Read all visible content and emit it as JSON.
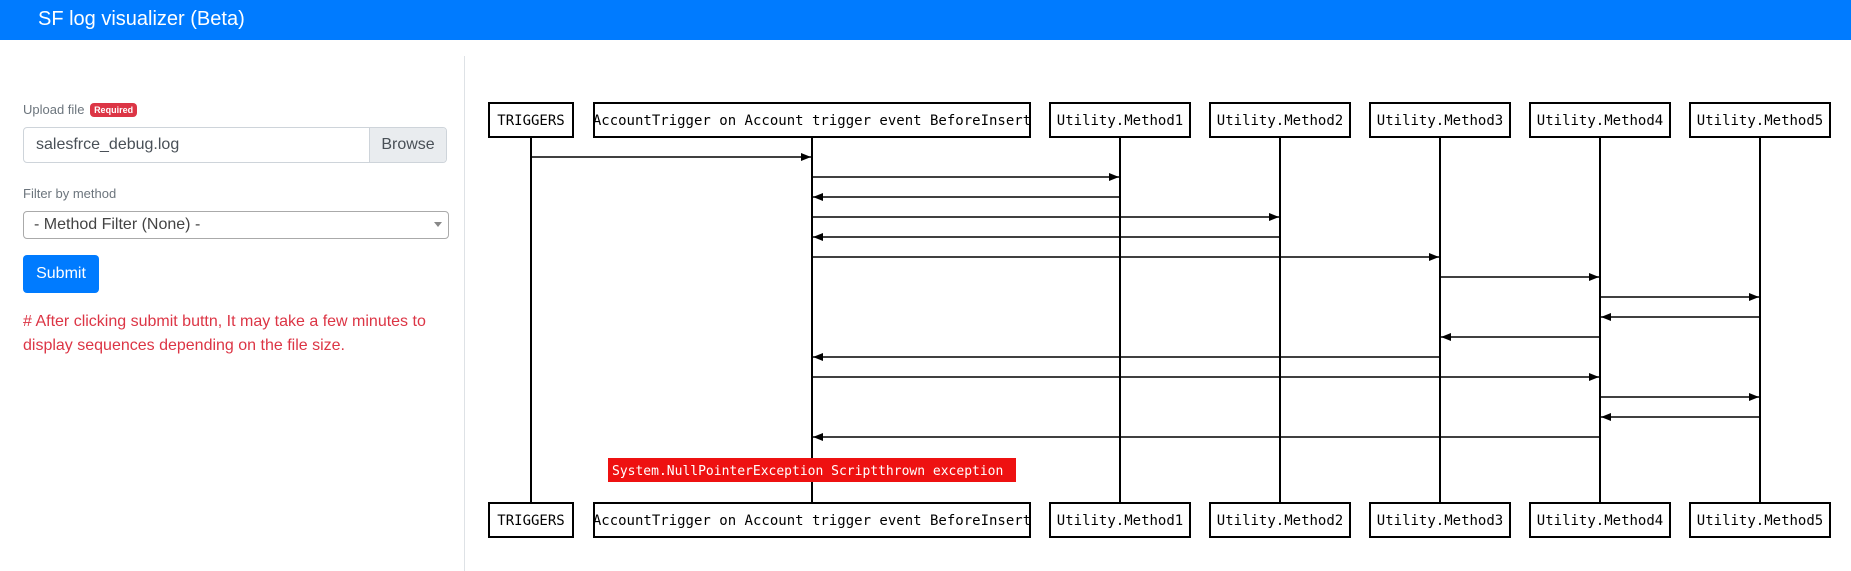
{
  "header": {
    "title": "SF log visualizer (Beta)"
  },
  "upload": {
    "label": "Upload file",
    "required_badge": "Required",
    "file_name": "salesfrce_debug.log",
    "browse_label": "Browse"
  },
  "filter": {
    "label": "Filter by method",
    "selected": "- Method Filter (None) -"
  },
  "submit_label": "Submit",
  "note": "# After clicking submit buttn, It may take a few minutes to display sequences depending on the file size.",
  "diagram": {
    "participants": [
      "TRIGGERS",
      "AccountTrigger on Account trigger event BeforeInsert",
      "Utility.Method1",
      "Utility.Method2",
      "Utility.Method3",
      "Utility.Method4",
      "Utility.Method5"
    ],
    "messages": [
      {
        "from": 0,
        "to": 1
      },
      {
        "from": 1,
        "to": 2
      },
      {
        "from": 2,
        "to": 1
      },
      {
        "from": 1,
        "to": 3
      },
      {
        "from": 3,
        "to": 1
      },
      {
        "from": 1,
        "to": 4
      },
      {
        "from": 4,
        "to": 5
      },
      {
        "from": 5,
        "to": 6
      },
      {
        "from": 6,
        "to": 5
      },
      {
        "from": 5,
        "to": 4
      },
      {
        "from": 4,
        "to": 1
      },
      {
        "from": 1,
        "to": 5
      },
      {
        "from": 5,
        "to": 6
      },
      {
        "from": 6,
        "to": 5
      },
      {
        "from": 5,
        "to": 1
      }
    ],
    "exception": {
      "text": "System.NullPointerException Scriptthrown exception",
      "color": "#ee1111"
    }
  }
}
